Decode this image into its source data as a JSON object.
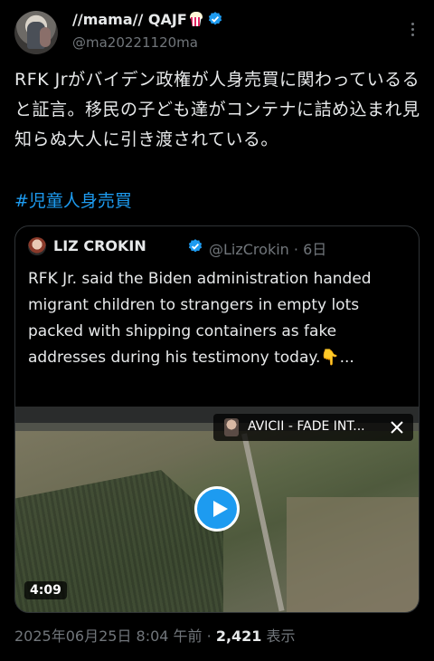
{
  "post": {
    "author_name": "//mama// QAJF",
    "author_handle": "@ma20221120ma",
    "text": "RFK Jrがバイデン政権が人身売買に関わっているると証言。移民の子ども達がコンテナに詰め込まれ見知らぬ大人に引き渡されている。",
    "hashtag": "#児童人身売買",
    "timestamp": "2025年06月25日 8:04 午前",
    "separator": "·",
    "views_count": "2,421",
    "views_label": "表示"
  },
  "quoted": {
    "author_name": "LIZ CROKIN",
    "author_handle": "@LizCrokin",
    "time_ago": "· 6日",
    "text": "RFK Jr. said the Biden administration handed migrant children to strangers in empty lots packed with shipping containers as fake addresses during his testimony today.👇..."
  },
  "video": {
    "music_title": "AVICII - FADE INT...",
    "duration": "4:09"
  },
  "colors": {
    "background": "#000000",
    "text": "#e7e9ea",
    "muted": "#71767b",
    "accent": "#1d9bf0"
  },
  "icons": [
    "verified-badge-icon",
    "more-icon",
    "play-icon",
    "close-icon",
    "popcorn-emoji-icon"
  ]
}
